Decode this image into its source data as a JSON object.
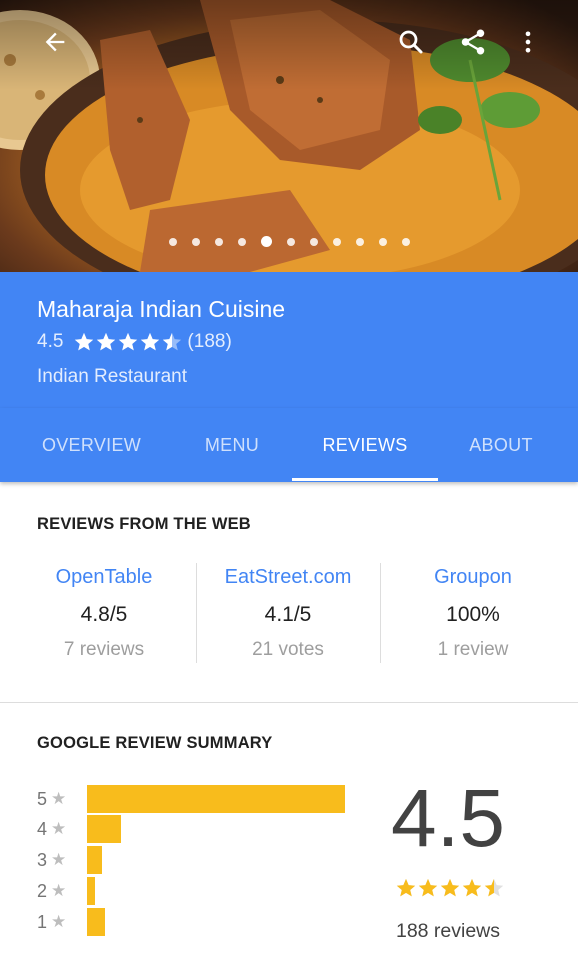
{
  "colors": {
    "brand_blue": "#4285f4",
    "star_yellow": "#f8bc1c",
    "link_blue": "#4285f4"
  },
  "topbar": {
    "back_icon": "arrow-back-icon",
    "search_icon": "search-icon",
    "share_icon": "share-icon",
    "more_icon": "more-vert-icon"
  },
  "carousel": {
    "total": 11,
    "active_index": 4
  },
  "place": {
    "name": "Maharaja Indian Cuisine",
    "rating": "4.5",
    "rating_value": 4.5,
    "rating_count_text": "(188)",
    "category": "Indian Restaurant"
  },
  "tabs": [
    {
      "label": "OVERVIEW",
      "active": false
    },
    {
      "label": "MENU",
      "active": false
    },
    {
      "label": "REVIEWS",
      "active": true
    },
    {
      "label": "ABOUT",
      "active": false
    }
  ],
  "web_reviews": {
    "title": "REVIEWS FROM THE WEB",
    "sources": [
      {
        "name": "OpenTable",
        "score": "4.8/5",
        "count": "7 reviews"
      },
      {
        "name": "EatStreet.com",
        "score": "4.1/5",
        "count": "21 votes"
      },
      {
        "name": "Groupon",
        "score": "100%",
        "count": "1 review"
      }
    ]
  },
  "summary": {
    "title": "GOOGLE REVIEW SUMMARY",
    "average": "4.5",
    "average_value": 4.5,
    "reviews_text": "188 reviews",
    "distribution": [
      {
        "stars": "5",
        "fraction": 1.0
      },
      {
        "stars": "4",
        "fraction": 0.13
      },
      {
        "stars": "3",
        "fraction": 0.06
      },
      {
        "stars": "2",
        "fraction": 0.03
      },
      {
        "stars": "1",
        "fraction": 0.07
      }
    ]
  }
}
